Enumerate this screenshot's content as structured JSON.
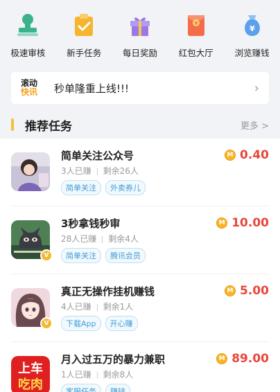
{
  "quick_actions": [
    {
      "label": "极速审核",
      "icon": "stamp-icon",
      "color": "#3ab38d"
    },
    {
      "label": "新手任务",
      "icon": "clipboard-check-icon",
      "color": "#f5b52e"
    },
    {
      "label": "每日奖励",
      "icon": "gift-icon",
      "color": "#9a79e6"
    },
    {
      "label": "红包大厅",
      "icon": "red-envelope-icon",
      "color": "#f36d4a"
    },
    {
      "label": "浏览赚钱",
      "icon": "money-bag-icon",
      "color": "#5aa0ec"
    }
  ],
  "ticker": {
    "logo_line1": "滚动",
    "logo_line2": "快讯",
    "text": "秒单隆重上线!!!"
  },
  "section": {
    "title": "推荐任务",
    "more": "更多 >"
  },
  "tasks": [
    {
      "title": "简单关注公众号",
      "earned": "3人已赚",
      "remaining": "剩余26人",
      "tags": [
        "简单关注",
        "外卖券儿"
      ],
      "reward": "0.40",
      "thumb": "girl-photo",
      "verified": false
    },
    {
      "title": "3秒拿钱秒审",
      "earned": "28人已赚",
      "remaining": "剩余4人",
      "tags": [
        "简单关注",
        "腾讯会员"
      ],
      "reward": "10.00",
      "thumb": "cartoon-cat",
      "verified": true
    },
    {
      "title": "真正无操作挂机赚钱",
      "earned": "4人已赚",
      "remaining": "剩余1人",
      "tags": [
        "下载App",
        "开心赚"
      ],
      "reward": "5.00",
      "thumb": "anime-girl",
      "verified": true
    },
    {
      "title": "月入过五万的暴力兼职",
      "earned": "1人已赚",
      "remaining": "剩余8人",
      "tags": [
        "客服任务",
        "赚钱"
      ],
      "reward": "89.00",
      "thumb": "上车吃肉",
      "verified": false
    }
  ],
  "coin_symbol": "M"
}
